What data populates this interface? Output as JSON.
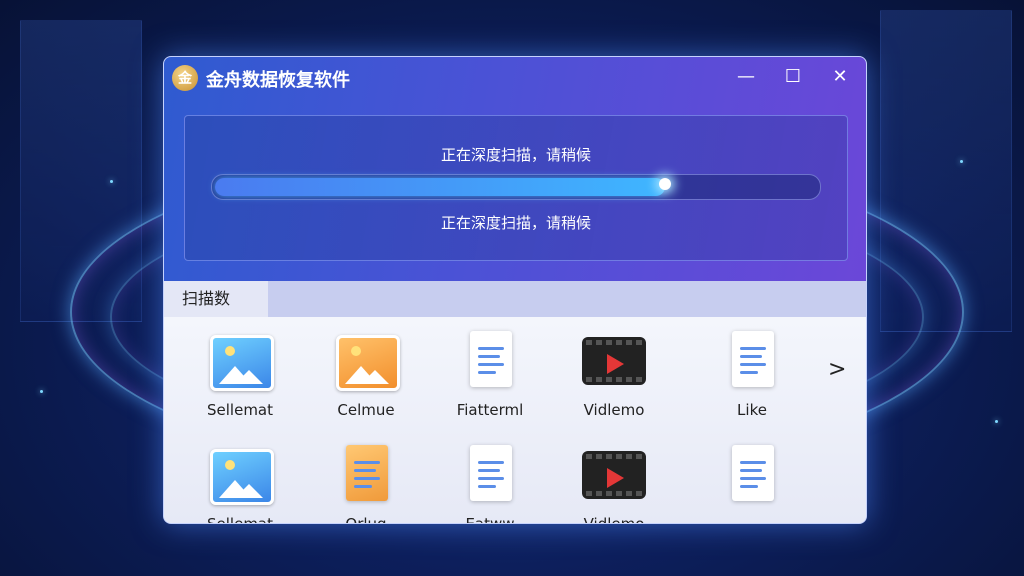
{
  "window": {
    "title": "金舟数据恢复软件",
    "logo_glyph": "金",
    "controls": {
      "minimize": "—",
      "maximize": "☐",
      "close": "✕"
    }
  },
  "scan": {
    "status_top": "正在深度扫描，请稍候",
    "status_bottom": "正在深度扫描，请稍候",
    "progress": 0.75
  },
  "tabs": {
    "active": "扫描数"
  },
  "files": [
    {
      "label": "Sellemat",
      "icon": "image-icon"
    },
    {
      "label": "Celmue",
      "icon": "image-icon"
    },
    {
      "label": "Fiatterml",
      "icon": "document-icon"
    },
    {
      "label": "Vidlemo",
      "icon": "video-icon"
    },
    {
      "label": "Like",
      "icon": "document-icon"
    },
    {
      "label": "Sellemat",
      "icon": "image-icon"
    },
    {
      "label": "Orlug",
      "icon": "document-icon"
    },
    {
      "label": "Eatww",
      "icon": "document-icon"
    },
    {
      "label": "Vidlemo",
      "icon": "video-icon"
    },
    {
      "label": "",
      "icon": "document-icon"
    }
  ],
  "next_arrow": ">",
  "colors": {
    "accent": "#3fb6ff",
    "titlebar": "#4b52d6"
  }
}
